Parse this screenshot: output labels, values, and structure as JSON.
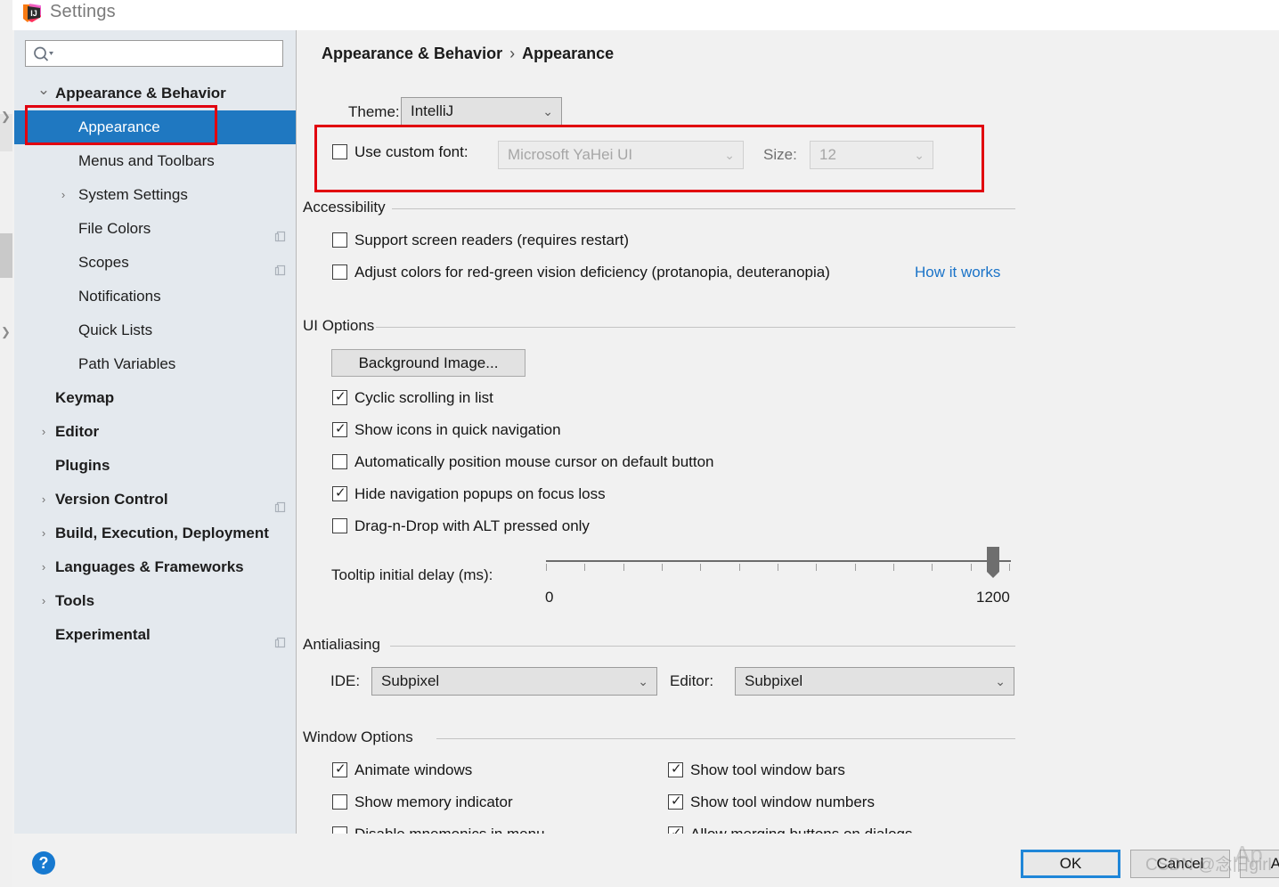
{
  "window": {
    "title": "Settings",
    "app_icon": "intellij-idea-icon"
  },
  "sidebar": {
    "search": {
      "value": "",
      "placeholder": "",
      "icon": "search-icon"
    },
    "items": [
      {
        "label": "Appearance & Behavior",
        "level": 0,
        "bold": true,
        "arrow": "expanded",
        "selected": false,
        "badge": false
      },
      {
        "label": "Appearance",
        "level": 1,
        "bold": false,
        "arrow": "none",
        "selected": true,
        "badge": false
      },
      {
        "label": "Menus and Toolbars",
        "level": 1,
        "bold": false,
        "arrow": "none",
        "selected": false,
        "badge": false
      },
      {
        "label": "System Settings",
        "level": 1,
        "bold": false,
        "arrow": "collapsed",
        "selected": false,
        "badge": false
      },
      {
        "label": "File Colors",
        "level": 1,
        "bold": false,
        "arrow": "none",
        "selected": false,
        "badge": true
      },
      {
        "label": "Scopes",
        "level": 1,
        "bold": false,
        "arrow": "none",
        "selected": false,
        "badge": true
      },
      {
        "label": "Notifications",
        "level": 1,
        "bold": false,
        "arrow": "none",
        "selected": false,
        "badge": false
      },
      {
        "label": "Quick Lists",
        "level": 1,
        "bold": false,
        "arrow": "none",
        "selected": false,
        "badge": false
      },
      {
        "label": "Path Variables",
        "level": 1,
        "bold": false,
        "arrow": "none",
        "selected": false,
        "badge": false
      },
      {
        "label": "Keymap",
        "level": 0,
        "bold": true,
        "arrow": "none",
        "selected": false,
        "badge": false
      },
      {
        "label": "Editor",
        "level": 0,
        "bold": true,
        "arrow": "collapsed",
        "selected": false,
        "badge": false
      },
      {
        "label": "Plugins",
        "level": 0,
        "bold": true,
        "arrow": "none",
        "selected": false,
        "badge": false
      },
      {
        "label": "Version Control",
        "level": 0,
        "bold": true,
        "arrow": "collapsed",
        "selected": false,
        "badge": true
      },
      {
        "label": "Build, Execution, Deployment",
        "level": 0,
        "bold": true,
        "arrow": "collapsed",
        "selected": false,
        "badge": false
      },
      {
        "label": "Languages & Frameworks",
        "level": 0,
        "bold": true,
        "arrow": "collapsed",
        "selected": false,
        "badge": false
      },
      {
        "label": "Tools",
        "level": 0,
        "bold": true,
        "arrow": "collapsed",
        "selected": false,
        "badge": false
      },
      {
        "label": "Experimental",
        "level": 0,
        "bold": true,
        "arrow": "none",
        "selected": false,
        "badge": true
      }
    ]
  },
  "breadcrumb": {
    "parent": "Appearance & Behavior",
    "separator": "›",
    "current": "Appearance"
  },
  "theme": {
    "label": "Theme:",
    "value": "IntelliJ"
  },
  "custom_font": {
    "checkbox_label": "Use custom font:",
    "checked": false,
    "font_value": "Microsoft YaHei UI",
    "size_label": "Size:",
    "size_value": "12",
    "disabled": true
  },
  "accessibility": {
    "group_title": "Accessibility",
    "options": [
      {
        "label": "Support screen readers (requires restart)",
        "checked": false
      },
      {
        "label": "Adjust colors for red-green vision deficiency (protanopia, deuteranopia)",
        "checked": false
      }
    ],
    "link": "How it works"
  },
  "ui_options": {
    "group_title": "UI Options",
    "background_image_button": "Background Image...",
    "options": [
      {
        "label": "Cyclic scrolling in list",
        "checked": true
      },
      {
        "label": "Show icons in quick navigation",
        "checked": true
      },
      {
        "label": "Automatically position mouse cursor on default button",
        "checked": false
      },
      {
        "label": "Hide navigation popups on focus loss",
        "checked": true
      },
      {
        "label": "Drag-n-Drop with ALT pressed only",
        "checked": false
      }
    ],
    "slider": {
      "label": "Tooltip initial delay (ms):",
      "min_label": "0",
      "max_label": "1200",
      "min": 0,
      "max": 1200,
      "value": 1200,
      "ticks": 13
    }
  },
  "antialiasing": {
    "group_title": "Antialiasing",
    "ide_label": "IDE:",
    "ide_value": "Subpixel",
    "editor_label": "Editor:",
    "editor_value": "Subpixel"
  },
  "window_options": {
    "group_title": "Window Options",
    "left_column": [
      {
        "label": "Animate windows",
        "checked": true
      },
      {
        "label": "Show memory indicator",
        "checked": false
      },
      {
        "label": "Disable mnemonics in menu",
        "checked": false
      }
    ],
    "right_column": [
      {
        "label": "Show tool window bars",
        "checked": true
      },
      {
        "label": "Show tool window numbers",
        "checked": true
      },
      {
        "label": "Allow merging buttons on dialogs",
        "checked": true
      }
    ]
  },
  "footer": {
    "help_label": "?",
    "ok_label": "OK",
    "cancel_label": "Cancel",
    "apply_label": "Apply"
  },
  "watermark": {
    "text": "CSDN @念旧girl",
    "text2": "Ap"
  },
  "colors": {
    "selection_blue": "#1f78c1",
    "annotation_red": "#e1000f",
    "link_blue": "#1a73c8",
    "sidebar_bg": "#e4e9ee",
    "panel_bg": "#f1f1f1",
    "default_button_border": "#1f86d8"
  }
}
